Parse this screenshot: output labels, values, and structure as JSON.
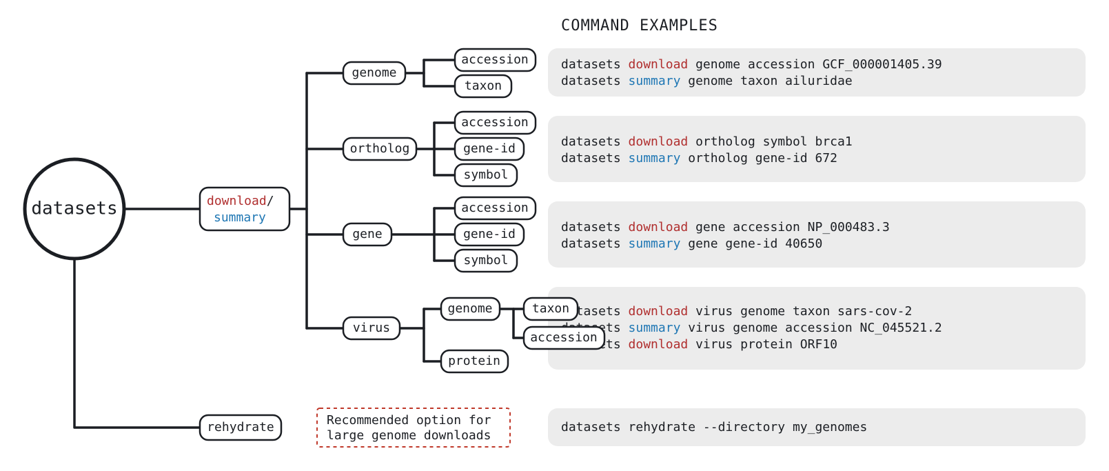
{
  "title": "COMMAND EXAMPLES",
  "root": "datasets",
  "downloadSummary": {
    "download": "download",
    "sep": "/",
    "summary": "summary"
  },
  "dsBox": {
    "download": "download",
    "sep": "/",
    "summary": "summary"
  },
  "nodes": {
    "genome": "genome",
    "ortholog": "ortholog",
    "gene": "gene",
    "virus": "virus",
    "rehydrate": "rehydrate",
    "accession": "accession",
    "taxon": "taxon",
    "geneid": "gene-id",
    "symbol": "symbol",
    "protein": "protein",
    "vgenome": "genome"
  },
  "note": {
    "l1": "Recommended option for",
    "l2": "large genome downloads"
  },
  "examples": {
    "genome": [
      {
        "pre": "datasets ",
        "kw": "download",
        "kwClass": "dl",
        "post": " genome accession GCF_000001405.39"
      },
      {
        "pre": "datasets ",
        "kw": "summary",
        "kwClass": "sm",
        "post": "  genome taxon ailuridae"
      }
    ],
    "ortholog": [
      {
        "pre": "datasets ",
        "kw": "download",
        "kwClass": "dl",
        "post": " ortholog symbol brca1"
      },
      {
        "pre": "datasets ",
        "kw": "summary",
        "kwClass": "sm",
        "post": "  ortholog gene-id 672"
      }
    ],
    "gene": [
      {
        "pre": "datasets ",
        "kw": "download",
        "kwClass": "dl",
        "post": " gene accession NP_000483.3"
      },
      {
        "pre": "datasets ",
        "kw": "summary",
        "kwClass": "sm",
        "post": "  gene gene-id 40650"
      }
    ],
    "virus": [
      {
        "pre": "datasets ",
        "kw": "download",
        "kwClass": "dl",
        "post": " virus genome taxon sars-cov-2"
      },
      {
        "pre": "datasets ",
        "kw": "summary",
        "kwClass": "sm",
        "post": "  virus genome accession NC_045521.2"
      },
      {
        "pre": "datasets ",
        "kw": "download",
        "kwClass": "dl",
        "post": " virus protein ORF10"
      }
    ],
    "rehydrate": [
      {
        "pre": "datasets rehydrate --directory my_genomes",
        "kw": "",
        "kwClass": "",
        "post": ""
      }
    ]
  }
}
